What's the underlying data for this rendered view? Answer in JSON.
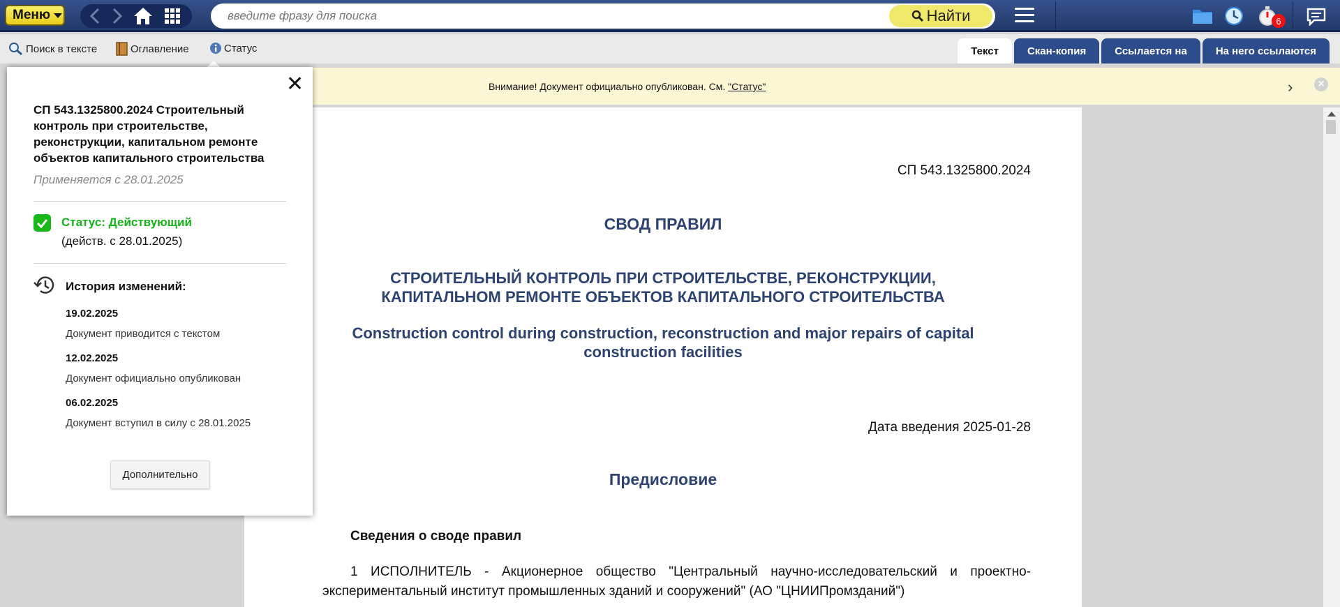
{
  "topbar": {
    "menu_label": "Меню",
    "search_placeholder": "введите фразу для поиска",
    "find_label": "Найти",
    "notifications_count": "6",
    "accent": "#22396a"
  },
  "toolbar": {
    "search_in_text": "Поиск в тексте",
    "contents": "Оглавление",
    "status": "Статус",
    "tabs": [
      {
        "label": "Текст",
        "active": true
      },
      {
        "label": "Скан-копия",
        "active": false
      },
      {
        "label": "Ссылается на",
        "active": false
      },
      {
        "label": "На него ссылаются",
        "active": false
      }
    ]
  },
  "notice": {
    "text": "Внимание! Документ официально опубликован. См. ",
    "link": "\"Статус\""
  },
  "document": {
    "code": "СП 543.1325800.2024",
    "heading": "СВОД ПРАВИЛ",
    "title_line1": "СТРОИТЕЛЬНЫЙ КОНТРОЛЬ ПРИ СТРОИТЕЛЬСТВЕ, РЕКОНСТРУКЦИИ,",
    "title_line2": "КАПИТАЛЬНОМ РЕМОНТЕ ОБЪЕКТОВ КАПИТАЛЬНОГО СТРОИТЕЛЬСТВА",
    "title_en_line1": "Construction control during construction, reconstruction and major repairs of capital",
    "title_en_line2": "construction facilities",
    "intro_date": "Дата введения 2025-01-28",
    "foreword": "Предисловие",
    "section": "Сведения о своде правил",
    "para1_line1": "1 ИСПОЛНИТЕЛЬ - Акционерное общество \"Центральный научно-исследовательский и проектно-",
    "para1_line2": "экспериментальный институт промышленных зданий и сооружений\" (АО \"ЦНИИПромзданий\")"
  },
  "popup": {
    "title": "СП 543.1325800.2024 Строительный контроль при строительстве, реконструкции, капитальном ремонте объектов капитального строительства",
    "applies": "Применяется с 28.01.2025",
    "status": "Статус: Действующий",
    "since": "(действ. с 28.01.2025)",
    "history_title": "История изменений:",
    "history": [
      {
        "date": "19.02.2025",
        "text": "Документ приводится с текстом"
      },
      {
        "date": "12.02.2025",
        "text": "Документ официально опубликован"
      },
      {
        "date": "06.02.2025",
        "text": "Документ вступил в силу с 28.01.2025"
      }
    ],
    "more_label": "Дополнительно"
  }
}
